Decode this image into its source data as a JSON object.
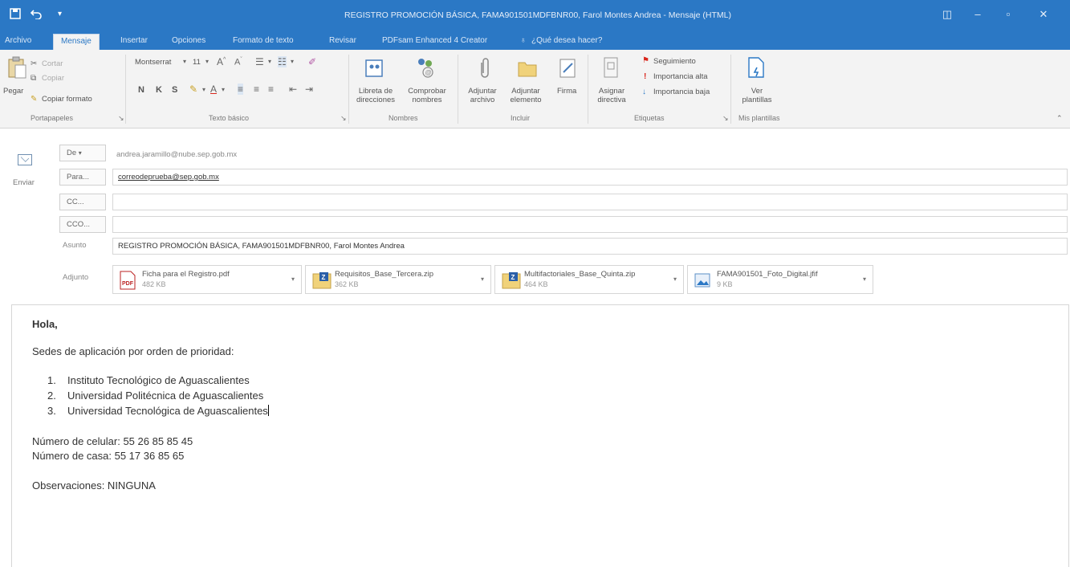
{
  "window": {
    "title": "REGISTRO PROMOCIÓN BÁSICA, FAMA901501MDFBNR00, Farol Montes Andrea - Mensaje (HTML)"
  },
  "ribbon_tabs": [
    "Archivo",
    "Mensaje",
    "Insertar",
    "Opciones",
    "Formato de texto",
    "Revisar",
    "PDFsam Enhanced 4 Creator",
    "¿Qué desea hacer?"
  ],
  "ribbon": {
    "clipboard": {
      "paste": "Pegar",
      "cut": "Cortar",
      "copy": "Copiar",
      "format_painter": "Copiar formato",
      "group": "Portapapeles"
    },
    "basic_text": {
      "font": "Montserrat",
      "size": "11",
      "bold": "N",
      "italic": "K",
      "underline": "S",
      "group": "Texto básico"
    },
    "names": {
      "address_book": "Libreta de direcciones",
      "check_names": "Comprobar nombres",
      "group": "Nombres"
    },
    "include": {
      "attach_file": "Adjuntar archivo",
      "attach_item": "Adjuntar elemento",
      "signature": "Firma",
      "group": "Incluir"
    },
    "tags": {
      "assign_policy": "Asignar directiva",
      "follow_up": "Seguimiento",
      "high_importance": "Importancia alta",
      "low_importance": "Importancia baja",
      "group": "Etiquetas"
    },
    "templates": {
      "view_templates": "Ver plantillas",
      "group": "Mis plantillas"
    }
  },
  "compose": {
    "send_label": "Enviar",
    "from_btn": "De",
    "from_value": "andrea.jaramillo@nube.sep.gob.mx",
    "to_btn": "Para...",
    "to_value": "correodeprueba@sep.gob.mx",
    "cc_btn": "CC...",
    "bcc_btn": "CCO...",
    "subject_label": "Asunto",
    "subject_value": "REGISTRO PROMOCIÓN BÁSICA, FAMA901501MDFBNR00, Farol Montes Andrea",
    "attached_label": "Adjunto"
  },
  "attachments": [
    {
      "name": "Ficha para el Registro.pdf",
      "size": "482 KB",
      "icon": "pdf-icon"
    },
    {
      "name": "Requisitos_Base_Tercera.zip",
      "size": "362 KB",
      "icon": "zip-icon"
    },
    {
      "name": "Multifactoriales_Base_Quinta.zip",
      "size": "464 KB",
      "icon": "zip-icon"
    },
    {
      "name": "FAMA901501_Foto_Digital.jfif",
      "size": "9 KB",
      "icon": "image-icon"
    }
  ],
  "body": {
    "greeting": "Hola,",
    "intro": "Sedes de aplicación por orden de prioridad:",
    "list": [
      {
        "num": "1.",
        "text": "Instituto Tecnológico de Aguascalientes"
      },
      {
        "num": "2.",
        "text": "Universidad Politécnica de Aguascalientes"
      },
      {
        "num": "3.",
        "text": "Universidad Tecnológica de Aguascalientes"
      }
    ],
    "mobile": "Número de celular: 55 26 85 85 45",
    "home": "Número de casa: 55 17 36 85 65",
    "notes": "Observaciones: NINGUNA"
  },
  "colors": {
    "accent": "#2b78c5",
    "ribbon_bg": "#f3f3f3"
  }
}
